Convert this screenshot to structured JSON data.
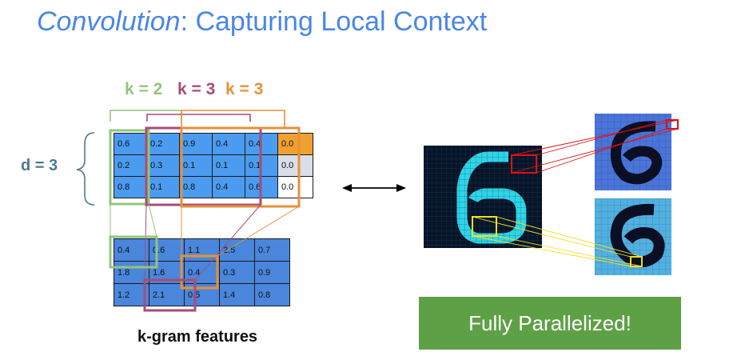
{
  "title": {
    "italic": "Convolution",
    "rest": ": Capturing Local Context"
  },
  "k_labels": [
    {
      "text": "k = 2",
      "color": "#93c47d"
    },
    {
      "text": "k = 3",
      "color": "#a64d79"
    },
    {
      "text": "k = 3",
      "color": "#e69138"
    }
  ],
  "d_label": "d = 3",
  "input_matrix": [
    [
      "0.6",
      "0.2",
      "0.9",
      "0.4",
      "0.4",
      "0.0"
    ],
    [
      "0.2",
      "0.3",
      "0.1",
      "0.1",
      "0.1",
      "0.0"
    ],
    [
      "0.8",
      "0.1",
      "0.8",
      "0.4",
      "0.6",
      "0.0"
    ]
  ],
  "feature_matrix": [
    [
      "0.4",
      "0.6",
      "1.1",
      "2.5",
      "0.7"
    ],
    [
      "1.8",
      "1.6",
      "0.4",
      "0.3",
      "0.9"
    ],
    [
      "1.2",
      "2.1",
      "0.5",
      "1.4",
      "0.8"
    ]
  ],
  "caption": "k-gram features",
  "button_label": "Fully Parallelized!",
  "colors": {
    "title": "#4a86e8",
    "k2": "#93c47d",
    "k3a": "#a64d79",
    "k3b": "#e69138",
    "cell_blue": "#4b9cf0",
    "button_green": "#5ea046"
  }
}
